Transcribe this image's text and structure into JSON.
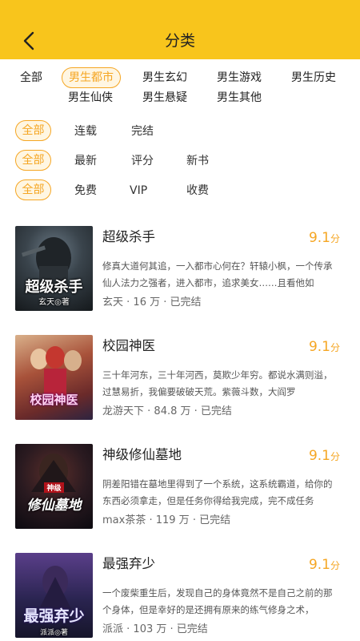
{
  "header": {
    "title": "分类",
    "accent": "#f8c51c"
  },
  "categories": [
    {
      "label": "全部",
      "selected": false
    },
    {
      "label": "男生都市",
      "selected": true
    },
    {
      "label": "男生玄幻",
      "selected": false
    },
    {
      "label": "男生游戏",
      "selected": false
    },
    {
      "label": "男生历史",
      "selected": false
    },
    {
      "label": "男生仙侠",
      "selected": false
    },
    {
      "label": "男生悬疑",
      "selected": false
    },
    {
      "label": "男生其他",
      "selected": false
    }
  ],
  "filters": {
    "status": [
      "全部",
      "连载",
      "完结"
    ],
    "sort": [
      "全部",
      "最新",
      "评分",
      "新书"
    ],
    "price": [
      "全部",
      "免费",
      "VIP",
      "收费"
    ]
  },
  "score_unit": "分",
  "highlight_color": "#f5a623",
  "books": [
    {
      "title": "超级杀手",
      "score": "9.1",
      "desc": "修真大道何其追，一入都市心何在？轩辕小枫，一个传承仙人法力之强者，进入都市，追求美女……且看他如",
      "author": "玄天",
      "count": "16 万",
      "status": "已完结",
      "cover_title": "超级杀手",
      "cover_sub": "玄天◎著"
    },
    {
      "title": "校园神医",
      "score": "9.1",
      "desc": "三十年河东，三十年河西，莫欺少年穷。都说水满则溢，过慧易折，我偏要破破天荒。紫薇斗数，大阎罗",
      "author": "龙游天下",
      "count": "84.8 万",
      "status": "已完结",
      "cover_title": "校园神医",
      "cover_sub": ""
    },
    {
      "title": "神级修仙墓地",
      "score": "9.1",
      "desc": "阴差阳错在墓地里得到了一个系统，这系统霸道，给你的东西必须拿走，但是任务你得给我完成，完不成任务",
      "author": "max茶茶",
      "count": "119 万",
      "status": "已完结",
      "cover_title": "修仙墓地",
      "cover_sub": "神级"
    },
    {
      "title": "最强弃少",
      "score": "9.1",
      "desc": "一个废柴重生后，发现自己的身体竟然不是自己之前的那个身体，但是幸好的是还拥有原来的练气修身之术，",
      "author": "派派",
      "count": "103 万",
      "status": "已完结",
      "cover_title": "最强弃少",
      "cover_sub": "派派◎著"
    }
  ]
}
